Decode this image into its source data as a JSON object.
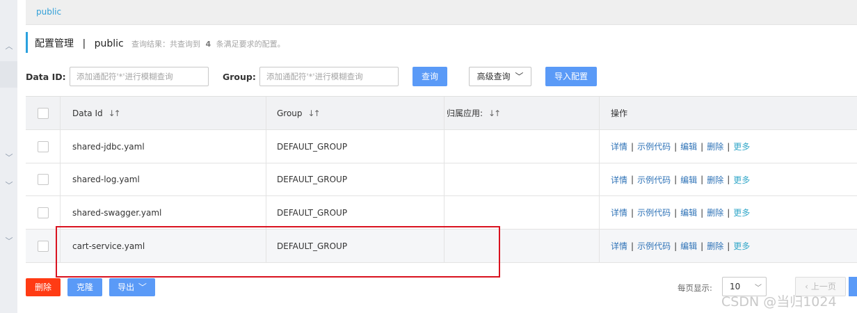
{
  "namespace": {
    "active": "public"
  },
  "header": {
    "title": "配置管理",
    "separator": "|",
    "namespace": "public",
    "result_prefix": "查询结果：共查询到",
    "result_count": "4",
    "result_suffix": "条满足要求的配置。"
  },
  "search": {
    "dataid_label": "Data ID:",
    "dataid_placeholder": "添加通配符'*'进行模糊查询",
    "group_label": "Group:",
    "group_placeholder": "添加通配符'*'进行模糊查询",
    "query_button": "查询",
    "advanced_button": "高级查询",
    "import_button": "导入配置"
  },
  "table": {
    "columns": [
      "Data Id",
      "Group",
      "归属应用:",
      "操作"
    ],
    "rows": [
      {
        "data_id": "shared-jdbc.yaml",
        "group": "DEFAULT_GROUP",
        "app": ""
      },
      {
        "data_id": "shared-log.yaml",
        "group": "DEFAULT_GROUP",
        "app": ""
      },
      {
        "data_id": "shared-swagger.yaml",
        "group": "DEFAULT_GROUP",
        "app": ""
      },
      {
        "data_id": "cart-service.yaml",
        "group": "DEFAULT_GROUP",
        "app": ""
      }
    ],
    "actions": {
      "detail": "详情",
      "sample": "示例代码",
      "edit": "编辑",
      "delete": "删除",
      "more": "更多",
      "sep": "|"
    }
  },
  "footer": {
    "delete_button": "删除",
    "clone_button": "克隆",
    "export_button": "导出",
    "page_size_label": "每页显示:",
    "page_size": "10",
    "prev_button": "上一页"
  },
  "watermark": "CSDN @当归1024",
  "colors": {
    "primary": "#5a9af7",
    "danger": "#ff3b14",
    "link": "#2f73b7",
    "accent": "#2aa1de",
    "highlight": "#d9121f"
  }
}
